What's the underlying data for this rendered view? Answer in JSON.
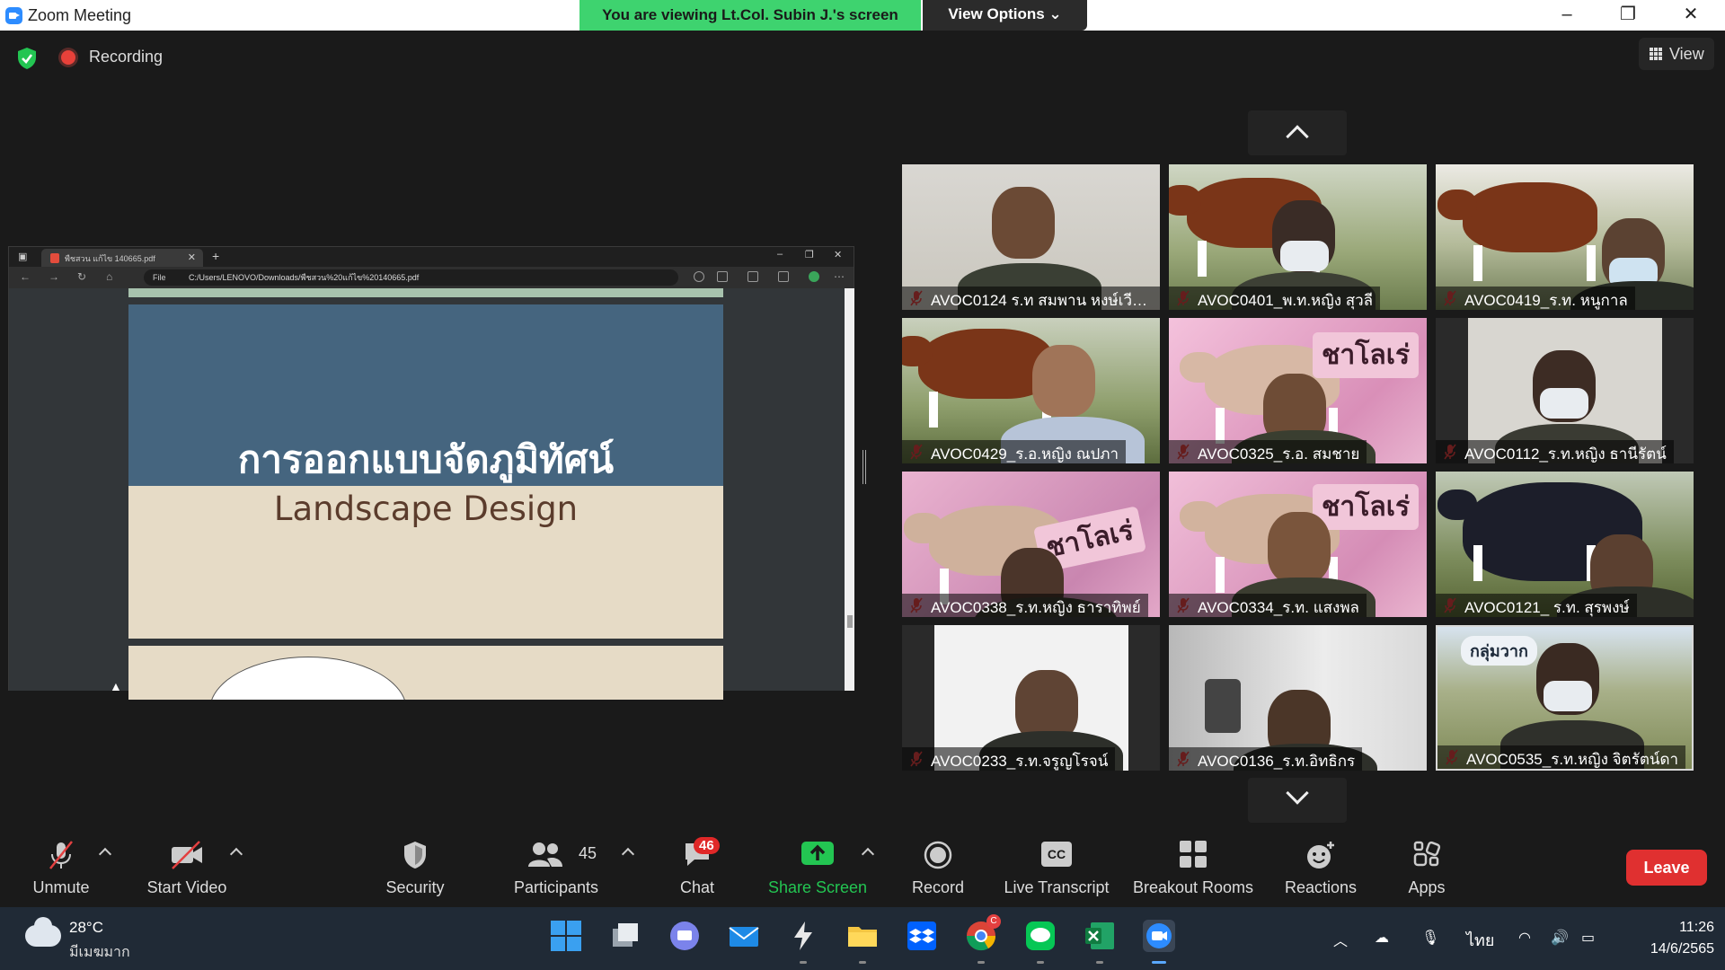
{
  "window": {
    "title": "Zoom Meeting",
    "share_banner": "You are viewing Lt.Col. Subin J.'s screen",
    "view_options": "View Options ⌄",
    "controls": [
      "–",
      "❐",
      "✕"
    ]
  },
  "status": {
    "recording_label": "Recording",
    "view_label": "View"
  },
  "shared_screen": {
    "tab_title": "พืชสวน แก้ไข 140665.pdf",
    "url_scheme": "File",
    "url": "C:/Users/LENOVO/Downloads/พืชสวน%20แก้ไข%20140665.pdf",
    "slide_title_th": "การออกแบบจัดภูมิทัศน์",
    "slide_title_en": "Landscape Design"
  },
  "participants": [
    {
      "name": "AVOC0124 ร.ท สมพาน หงษ์เวีย...",
      "muted": true
    },
    {
      "name": "AVOC0401_พ.ท.หญิง สุวลี",
      "muted": true
    },
    {
      "name": "AVOC0419_ร.ท. หนูกาล",
      "muted": true
    },
    {
      "name": "AVOC0429_ร.อ.หญิง ณปภา",
      "muted": true
    },
    {
      "name": "AVOC0325_ร.อ. สมชาย",
      "muted": true
    },
    {
      "name": "AVOC0112_ร.ท.หญิง ธานีรัตน์",
      "muted": true
    },
    {
      "name": "AVOC0338_ร.ท.หญิง ธาราทิพย์",
      "muted": true
    },
    {
      "name": "AVOC0334_ร.ท. แสงพล",
      "muted": true
    },
    {
      "name": "AVOC0121_ ร.ท. สุรพงษ์",
      "muted": true
    },
    {
      "name": "AVOC0233_ร.ท.จรูญโรจน์",
      "muted": true
    },
    {
      "name": "AVOC0136_ร.ท.อิทธิกร",
      "muted": true
    },
    {
      "name": "AVOC0535_ร.ท.หญิง จิตรัตน์ดา",
      "muted": true
    }
  ],
  "backgrounds": {
    "sign_text": "ชาโลเร่",
    "sign_text2": "กลุ่มวาก"
  },
  "toolbar": {
    "unmute": "Unmute",
    "start_video": "Start Video",
    "security": "Security",
    "participants": "Participants",
    "participants_count": "45",
    "chat": "Chat",
    "chat_badge": "46",
    "share_screen": "Share Screen",
    "record": "Record",
    "live_transcript": "Live Transcript",
    "transcript_icon": "CC",
    "breakout_rooms": "Breakout Rooms",
    "reactions": "Reactions",
    "apps": "Apps",
    "leave": "Leave"
  },
  "taskbar": {
    "temperature": "28°C",
    "weather": "มีเมฆมาก",
    "language": "ไทย",
    "time": "11:26",
    "date": "14/6/2565",
    "chrome_badge": "C"
  },
  "colors": {
    "zoom_blue": "#2d8cff",
    "banner_green": "#3ed36f",
    "leave_red": "#e03030",
    "share_green": "#23c552",
    "muted_red": "#e34040"
  }
}
